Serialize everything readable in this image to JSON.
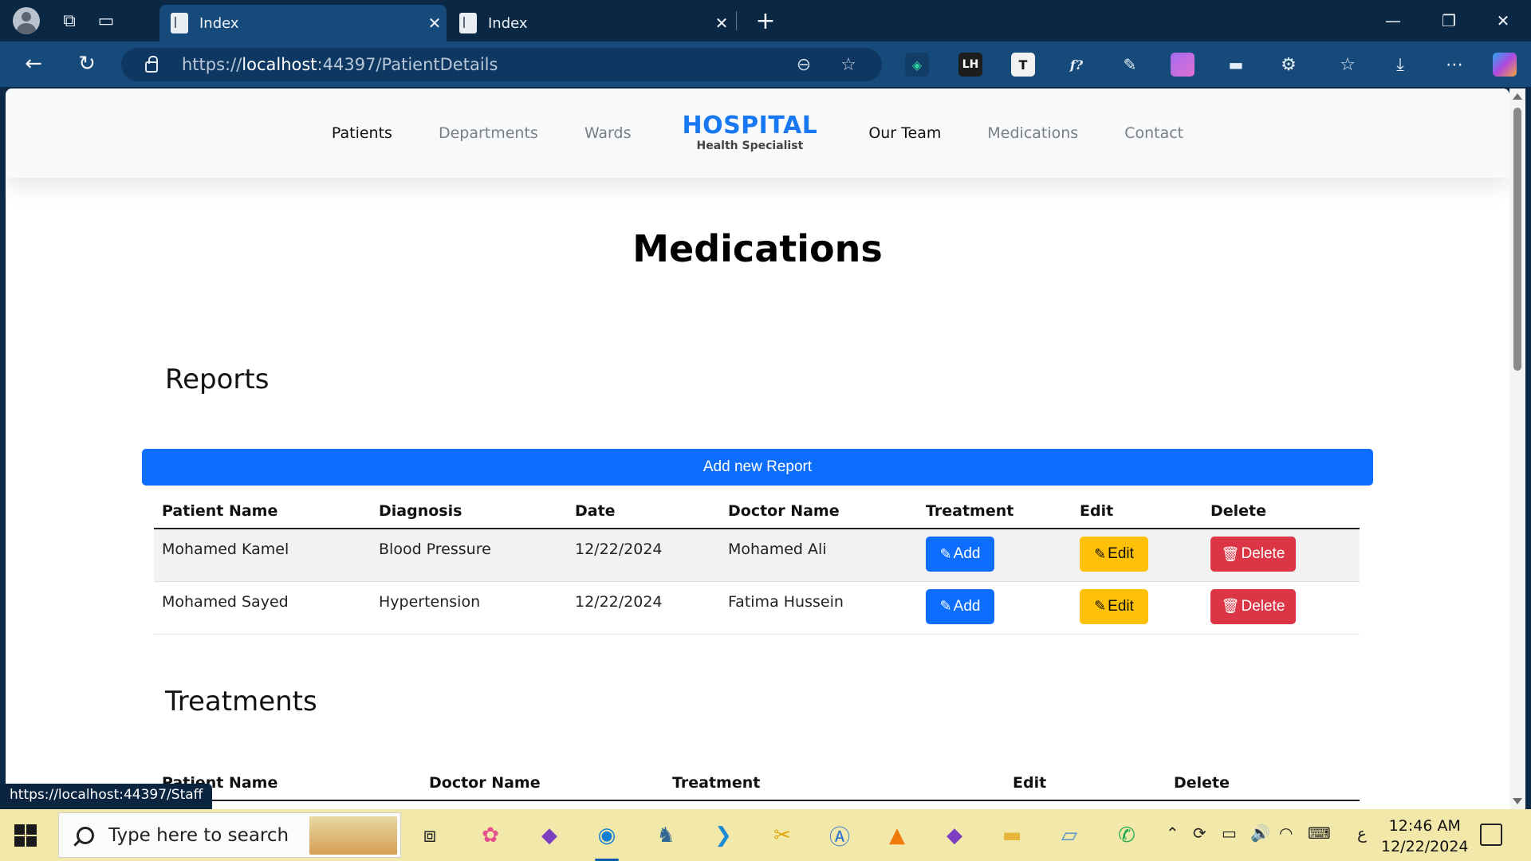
{
  "browser": {
    "tabs": [
      {
        "title": "Index",
        "active": true
      },
      {
        "title": "Index",
        "active": false
      }
    ],
    "url_prefix": "https://",
    "url_host": "localhost",
    "url_path": ":44397/PatientDetails",
    "status_url": "https://localhost:44397/Staff"
  },
  "site": {
    "brand_main": "HOSPITAL",
    "brand_sub": "Health Specialist",
    "nav_left": [
      "Patients",
      "Departments",
      "Wards"
    ],
    "nav_right": [
      "Our Team",
      "Medications",
      "Contact"
    ],
    "page_title": "Medications"
  },
  "reports": {
    "heading": "Reports",
    "add_button": "Add new Report",
    "columns": [
      "Patient Name",
      "Diagnosis",
      "Date",
      "Doctor Name",
      "Treatment",
      "Edit",
      "Delete"
    ],
    "rows": [
      {
        "patient": "Mohamed Kamel",
        "diagnosis": "Blood Pressure",
        "date": "12/22/2024",
        "doctor": "Mohamed Ali"
      },
      {
        "patient": "Mohamed Sayed",
        "diagnosis": "Hypertension",
        "date": "12/22/2024",
        "doctor": "Fatima Hussein"
      }
    ],
    "btn_add": "Add",
    "btn_edit": "Edit",
    "btn_delete": "Delete"
  },
  "treatments": {
    "heading": "Treatments",
    "columns": [
      "Patient Name",
      "Doctor Name",
      "Treatment",
      "Edit",
      "Delete"
    ]
  },
  "taskbar": {
    "search_placeholder": "Type here to search",
    "time": "12:46 AM",
    "date": "12/22/2024",
    "lang": "ع"
  },
  "colors": {
    "primary": "#0d6efd",
    "warning": "#ffc107",
    "danger": "#dc3545",
    "brand": "#1877f2"
  }
}
